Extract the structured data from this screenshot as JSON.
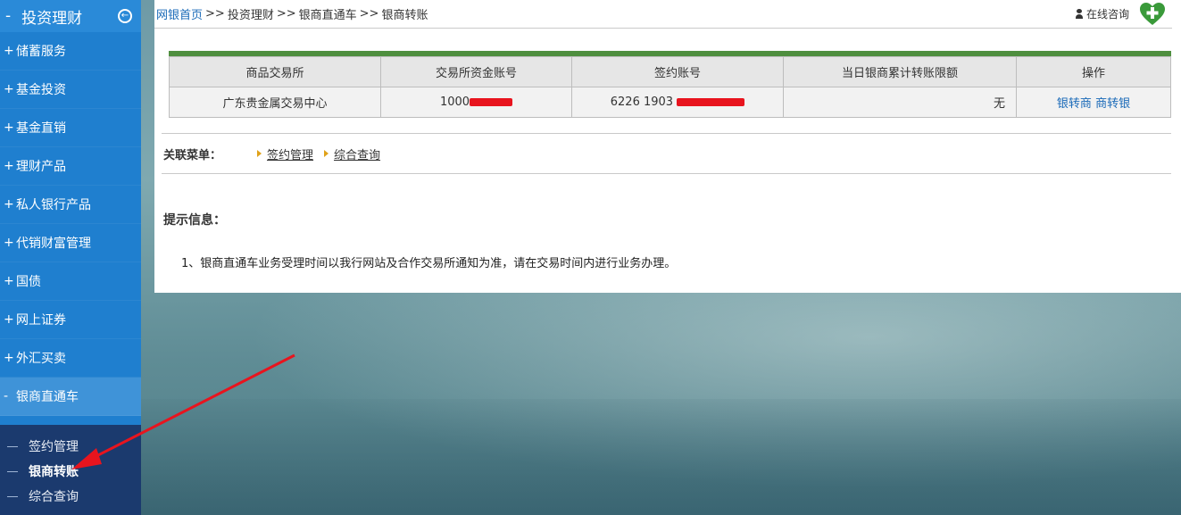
{
  "sidebar": {
    "title": "投资理财",
    "title_sign": "-",
    "collapse_icon": "collapse-circle-icon",
    "items": [
      {
        "sign": "+",
        "label": "储蓄服务"
      },
      {
        "sign": "+",
        "label": "基金投资"
      },
      {
        "sign": "+",
        "label": "基金直销"
      },
      {
        "sign": "+",
        "label": "理财产品"
      },
      {
        "sign": "+",
        "label": "私人银行产品"
      },
      {
        "sign": "+",
        "label": "代销财富管理"
      },
      {
        "sign": "+",
        "label": "国债"
      },
      {
        "sign": "+",
        "label": "网上证券"
      },
      {
        "sign": "+",
        "label": "外汇买卖"
      },
      {
        "sign": "-",
        "label": "银商直通车"
      }
    ],
    "submenu": [
      {
        "label": "签约管理"
      },
      {
        "label": "银商转账"
      },
      {
        "label": "综合查询"
      }
    ]
  },
  "breadcrumb": {
    "home": "网银首页",
    "sep": ">>",
    "level1": "投资理财",
    "level2": "银商直通车",
    "level3": "银商转账"
  },
  "consult": {
    "label": "在线咨询",
    "icon": "person-icon",
    "badge_icon": "add-heart-icon"
  },
  "table": {
    "headers": [
      "商品交易所",
      "交易所资金账号",
      "签约账号",
      "当日银商累计转账限额",
      "操作"
    ],
    "row": {
      "exchange": "广东贵金属交易中心",
      "fund_account_prefix": "1000",
      "sign_account_prefix": "6226 1903",
      "limit": "无",
      "op1": "银转商",
      "op2": "商转银"
    }
  },
  "related": {
    "title": "关联菜单：",
    "links": [
      "签约管理",
      "综合查询"
    ]
  },
  "tips": {
    "title": "提示信息：",
    "line1": "1、银商直通车业务受理时间以我行网站及合作交易所通知为准，请在交易时间内进行业务办理。"
  },
  "colors": {
    "sidebar": "#1f7fcf",
    "sidebar_active": "#3f93d8",
    "submenu": "#1b3a6e",
    "link": "#1a6ab8",
    "table_accent": "#4f8f3f",
    "annotation_arrow": "#e8141e"
  }
}
